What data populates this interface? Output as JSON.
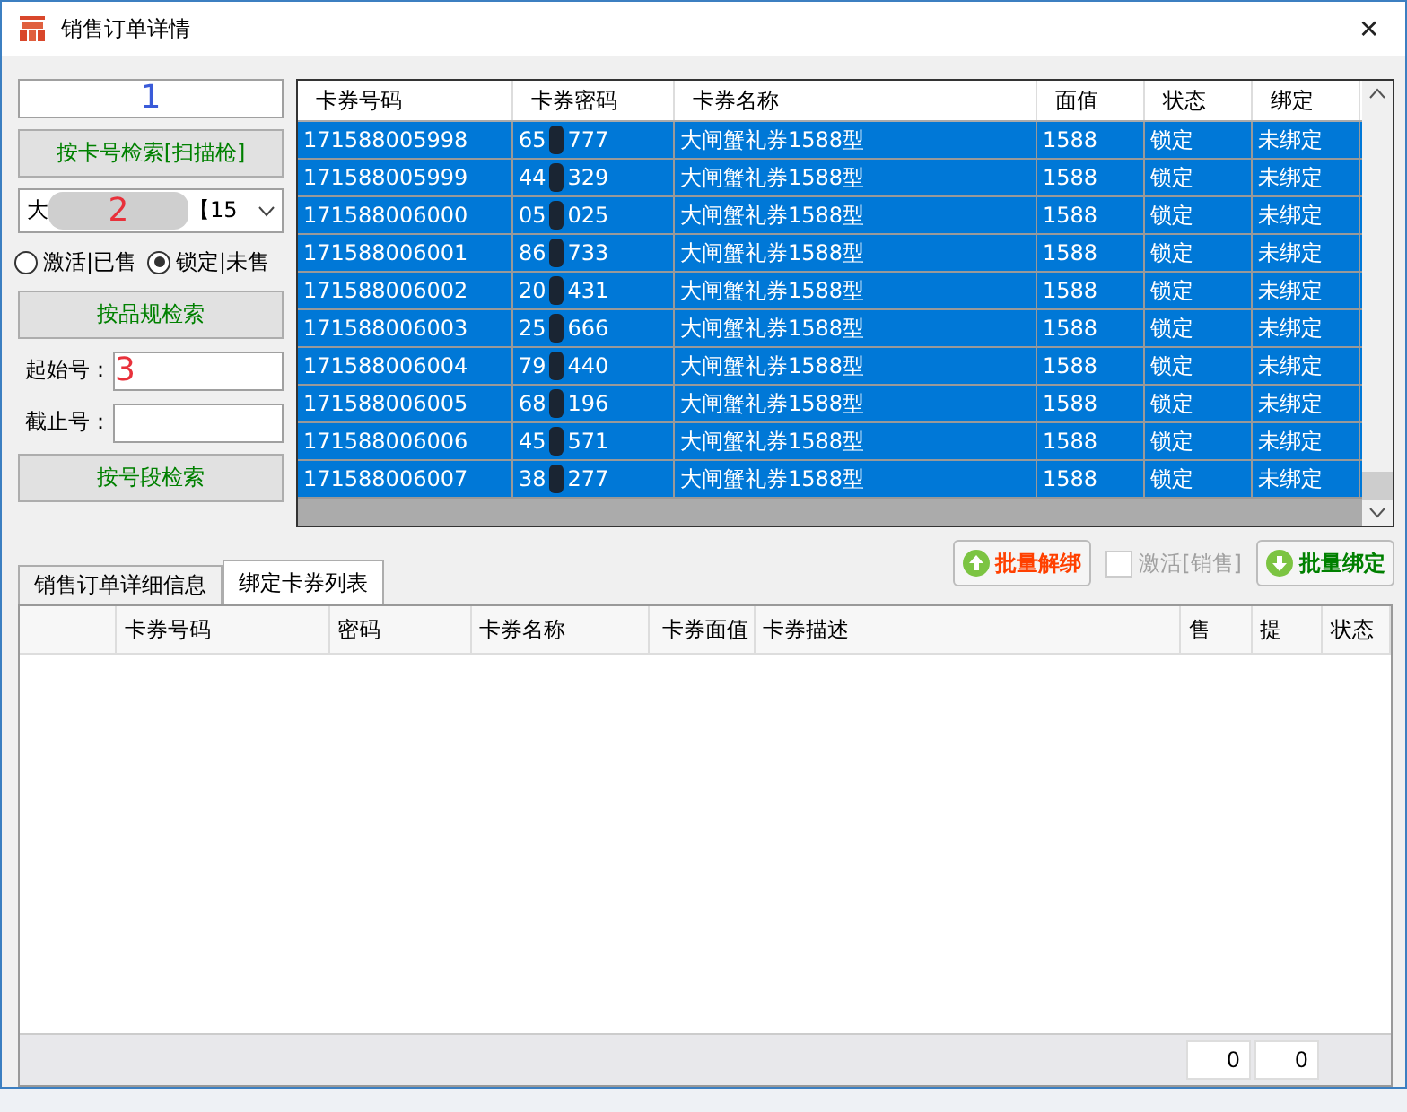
{
  "window": {
    "title": "销售订单详情",
    "close": "✕"
  },
  "left_panel": {
    "card_field": {
      "value": "1"
    },
    "card_search_button": "按卡号检索[扫描枪]",
    "spec_dropdown": {
      "value_start": "大",
      "annotation": "2",
      "value_end": "【15"
    },
    "radios": [
      {
        "label": "激活|已售",
        "selected": false
      },
      {
        "label": "锁定|未售",
        "selected": true
      }
    ],
    "spec_search_button": "按品规检索",
    "start_field": {
      "label": "起始号：",
      "value": "3"
    },
    "end_field": {
      "label": "截止号："
    },
    "range_search_button": "按号段检索"
  },
  "card_table": {
    "columns": [
      "卡券号码",
      "卡券密码",
      "卡券名称",
      "面值",
      "状态",
      "绑定"
    ],
    "rows": [
      {
        "number": "171588005998",
        "pass_start": "65",
        "pass_end": "777",
        "name": "大闸蟹礼券1588型",
        "value": "1588",
        "status": "锁定",
        "bound": "未绑定",
        "selected": true
      },
      {
        "number": "171588005999",
        "pass_start": "44",
        "pass_end": "329",
        "name": "大闸蟹礼券1588型",
        "value": "1588",
        "status": "锁定",
        "bound": "未绑定",
        "selected": true
      },
      {
        "number": "171588006000",
        "pass_start": "05",
        "pass_end": "025",
        "name": "大闸蟹礼券1588型",
        "value": "1588",
        "status": "锁定",
        "bound": "未绑定",
        "selected": true
      },
      {
        "number": "171588006001",
        "pass_start": "86",
        "pass_end": "733",
        "name": "大闸蟹礼券1588型",
        "value": "1588",
        "status": "锁定",
        "bound": "未绑定",
        "selected": true
      },
      {
        "number": "171588006002",
        "pass_start": "20",
        "pass_end": "431",
        "name": "大闸蟹礼券1588型",
        "value": "1588",
        "status": "锁定",
        "bound": "未绑定",
        "selected": true
      },
      {
        "number": "171588006003",
        "pass_start": "25",
        "pass_end": "666",
        "name": "大闸蟹礼券1588型",
        "value": "1588",
        "status": "锁定",
        "bound": "未绑定",
        "selected": true
      },
      {
        "number": "171588006004",
        "pass_start": "79",
        "pass_end": "440",
        "name": "大闸蟹礼券1588型",
        "value": "1588",
        "status": "锁定",
        "bound": "未绑定",
        "selected": true
      },
      {
        "number": "171588006005",
        "pass_start": "68",
        "pass_end": "196",
        "name": "大闸蟹礼券1588型",
        "value": "1588",
        "status": "锁定",
        "bound": "未绑定",
        "selected": true
      },
      {
        "number": "171588006006",
        "pass_start": "45",
        "pass_end": "571",
        "name": "大闸蟹礼券1588型",
        "value": "1588",
        "status": "锁定",
        "bound": "未绑定",
        "selected": true
      },
      {
        "number": "171588006007",
        "pass_start": "38",
        "pass_end": "277",
        "name": "大闸蟹礼券1588型",
        "value": "1588",
        "status": "锁定",
        "bound": "未绑定",
        "selected": true
      }
    ]
  },
  "actions": {
    "unbind_button": "批量解绑",
    "activate_checkbox": {
      "label": "激活[销售]",
      "checked": false,
      "disabled": true
    },
    "bind_button": "批量绑定"
  },
  "tabs": [
    {
      "label": "销售订单详细信息",
      "selected": false
    },
    {
      "label": "绑定卡券列表",
      "selected": true
    }
  ],
  "bound_table": {
    "columns": [
      "",
      "卡券号码",
      "密码",
      "卡券名称",
      "卡券面值",
      "卡券描述",
      "售",
      "提",
      "状态"
    ]
  },
  "footer": {
    "count_1": "0",
    "count_2": "0"
  }
}
